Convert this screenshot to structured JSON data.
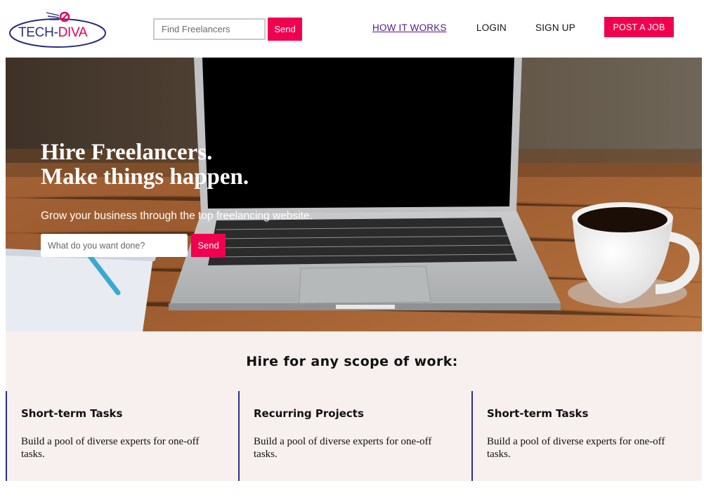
{
  "header": {
    "logo": {
      "part1": "TECH-",
      "part2": "DIVA"
    },
    "search": {
      "placeholder": "Find Freelancers",
      "button_label": "Send"
    },
    "nav": {
      "how_it_works": "HOW IT WORKS",
      "login": "LOGIN",
      "sign_up": "SIGN UP"
    },
    "post_job_label": "POST A JOB"
  },
  "hero": {
    "title_line1": "Hire Freelancers.",
    "title_line2": "Make things happen.",
    "subtitle": "Grow your business through the top freelancing website.",
    "search": {
      "placeholder": "What do you want done?",
      "button_label": "Send"
    }
  },
  "scope": {
    "heading": "Hire for any scope of work:",
    "cards": [
      {
        "title": "Short-term Tasks",
        "text": "Build a pool of diverse experts for one-off tasks."
      },
      {
        "title": "Recurring Projects",
        "text": "Build a pool of diverse experts for one-off tasks."
      },
      {
        "title": "Short-term Tasks",
        "text": "Build a pool of diverse experts for one-off tasks."
      }
    ]
  },
  "colors": {
    "accent": "#f0004f",
    "logo_navy": "#2a2f7a",
    "logo_pink": "#e0005a",
    "card_border": "#2a2f8a",
    "section_bg": "#f8f0ee",
    "visited_link": "#551a8b"
  },
  "icons": [
    "logo-rocket-icon"
  ]
}
